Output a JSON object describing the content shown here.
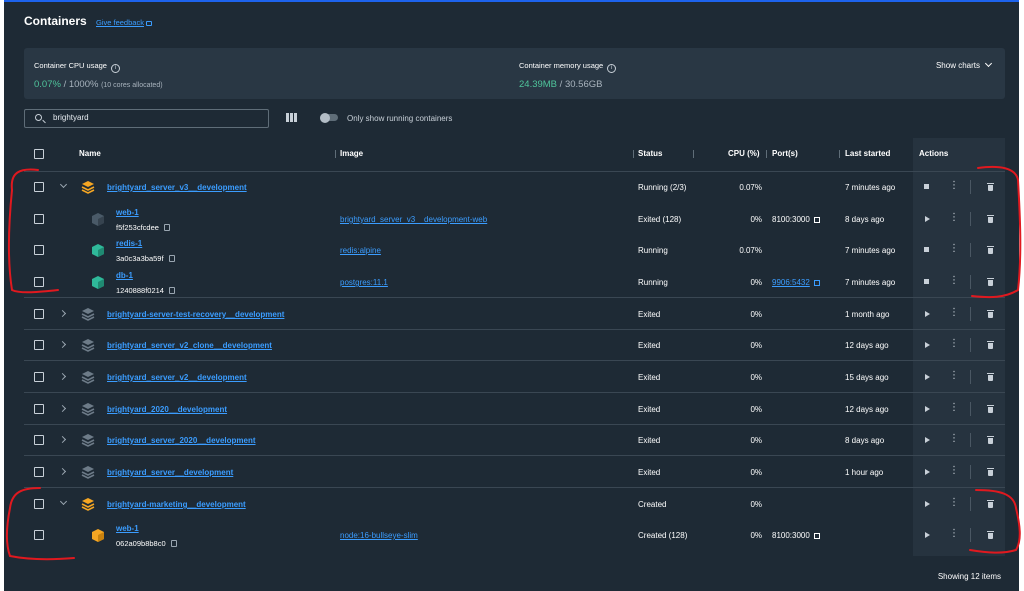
{
  "header": {
    "title": "Containers",
    "feedback_label": "Give feedback"
  },
  "stats": {
    "cpu_label": "Container CPU usage",
    "cpu_used": "0.07%",
    "cpu_total": " / 1000%",
    "cpu_note": "(10 cores allocated)",
    "mem_label": "Container memory usage",
    "mem_used": "24.39MB",
    "mem_total": " / 30.56GB",
    "show_charts_label": "Show charts"
  },
  "toolbar": {
    "search_value": "brightyard",
    "toggle_label": "Only show running containers"
  },
  "table": {
    "headers": {
      "name": "Name",
      "image": "Image",
      "status": "Status",
      "cpu": "CPU (%)",
      "ports": "Port(s)",
      "started": "Last started",
      "actions": "Actions"
    },
    "rows": [
      {
        "name": "brightyard_server_v3__development",
        "status": "Running (2/3)",
        "cpu": "0.07%",
        "started": "7 minutes ago"
      },
      {
        "name": "web-1",
        "id": "f5f253cfcdee",
        "image": "brightyard_server_v3__development-web",
        "status": "Exited (128)",
        "cpu": "0%",
        "port": "8100:3000",
        "started": "8 days ago"
      },
      {
        "name": "redis-1",
        "id": "3a0c3a3ba59f",
        "image": "redis:alpine",
        "status": "Running",
        "cpu": "0.07%",
        "started": "7 minutes ago"
      },
      {
        "name": "db-1",
        "id": "1240888f0214",
        "image": "postgres:11.1",
        "status": "Running",
        "cpu": "0%",
        "port": "9906:5432",
        "started": "7 minutes ago"
      },
      {
        "name": "brightyard-server-test-recovery__development",
        "status": "Exited",
        "cpu": "0%",
        "started": "1 month ago"
      },
      {
        "name": "brightyard_server_v2_clone__development",
        "status": "Exited",
        "cpu": "0%",
        "started": "12 days ago"
      },
      {
        "name": "brightyard_server_v2__development",
        "status": "Exited",
        "cpu": "0%",
        "started": "15 days ago"
      },
      {
        "name": "brightyard_2020__development",
        "status": "Exited",
        "cpu": "0%",
        "started": "12 days ago"
      },
      {
        "name": "brightyard_server_2020__development",
        "status": "Exited",
        "cpu": "0%",
        "started": "8 days ago"
      },
      {
        "name": "brightyard_server__development",
        "status": "Exited",
        "cpu": "0%",
        "started": "1 hour ago"
      },
      {
        "name": "brightyard-marketing__development",
        "status": "Created",
        "cpu": "0%",
        "started": ""
      },
      {
        "name": "web-1",
        "id": "062a09b8b8c0",
        "image": "node:16-bullseye-slim",
        "status": "Created (128)",
        "cpu": "0%",
        "port": "8100:3000",
        "started": ""
      }
    ]
  },
  "footer": {
    "count_label": "Showing 12 items"
  },
  "colors": {
    "background": "#1e2a35",
    "panel": "#293744",
    "accent_link": "#3b9dff",
    "cpu_green": "#4fc49b",
    "stack_orange": "#f5a623",
    "container_teal": "#2fb99a",
    "annotation_red": "#e0191f"
  }
}
